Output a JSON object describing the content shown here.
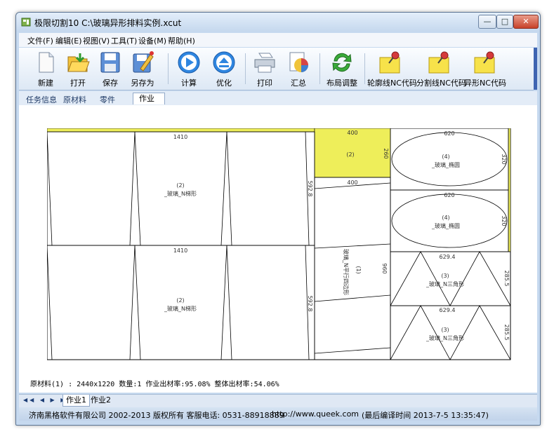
{
  "window": {
    "title": "极限切割10  C:\\玻璃异形排料实例.xcut",
    "controls": {
      "minimize": "—",
      "maximize": "□",
      "close": "✕"
    }
  },
  "menu": [
    "文件(F)",
    "编辑(E)",
    "视图(V)",
    "工具(T)",
    "设备(M)",
    "帮助(H)"
  ],
  "toolbar": [
    {
      "label": "新建",
      "icon": "new-file-icon"
    },
    {
      "label": "打开",
      "icon": "open-folder-icon"
    },
    {
      "label": "保存",
      "icon": "save-disk-icon"
    },
    {
      "label": "另存为",
      "icon": "save-as-icon"
    },
    {
      "label": "计算",
      "icon": "play-icon"
    },
    {
      "label": "优化",
      "icon": "eject-icon"
    },
    {
      "label": "打印",
      "icon": "printer-icon"
    },
    {
      "label": "汇总",
      "icon": "pie-chart-icon"
    },
    {
      "label": "布局调整",
      "icon": "refresh-arrows-icon"
    },
    {
      "label": "轮廓线NC代码",
      "icon": "pushpin-icon"
    },
    {
      "label": "分割线NC代码",
      "icon": "pushpin-icon"
    },
    {
      "label": "异形NC代码",
      "icon": "pushpin-icon"
    }
  ],
  "tabs": [
    "任务信息",
    "原材料",
    "零件",
    "作业"
  ],
  "active_tab": "作业",
  "layout": {
    "trapezoid_1": {
      "width": "1410",
      "height": "592.8",
      "id": "(2)",
      "name": "_玻璃_N梯形"
    },
    "trapezoid_2": {
      "width": "1410",
      "height": "592.8",
      "id": "(2)",
      "name": "_玻璃_N梯形"
    },
    "rect_small": {
      "width": "400",
      "height": "260",
      "id": "(2)"
    },
    "parallelogram": {
      "width": "400",
      "height": "960",
      "id": "(1)",
      "name": "玻璃_N平行四边形"
    },
    "ellipse_1": {
      "width": "620",
      "height": "320",
      "id": "(4)",
      "name": "_玻璃_椭圆"
    },
    "ellipse_2": {
      "width": "620",
      "height": "320",
      "id": "(4)",
      "name": "_玻璃_椭圆"
    },
    "triangle_1": {
      "width": "629.4",
      "height": "285.5",
      "id": "(3)",
      "name": "_玻璃_N三角形"
    },
    "triangle_2": {
      "width": "629.4",
      "height": "285.5",
      "id": "(3)",
      "name": "_玻璃_N三角形"
    }
  },
  "stats": "原材料(1)  :  2440x1220   数量:1   作业出材率:95.08%  整体出材率:54.06%",
  "sheet_nav": "◀◀ ◀ ▶ ▶▶",
  "sheets": [
    "作业1",
    "作业2"
  ],
  "active_sheet": "作业1",
  "statusbar": {
    "company": "济南黑格软件有限公司  2002-2013 版权所有  客服电话: 0531-88918889",
    "url": "http://www.queek.com",
    "compile_time": "(最后编译时间 2013-7-5 13:35:47)"
  },
  "colors": {
    "accent": "#3e64b1",
    "highlight": "#eeee5a"
  }
}
